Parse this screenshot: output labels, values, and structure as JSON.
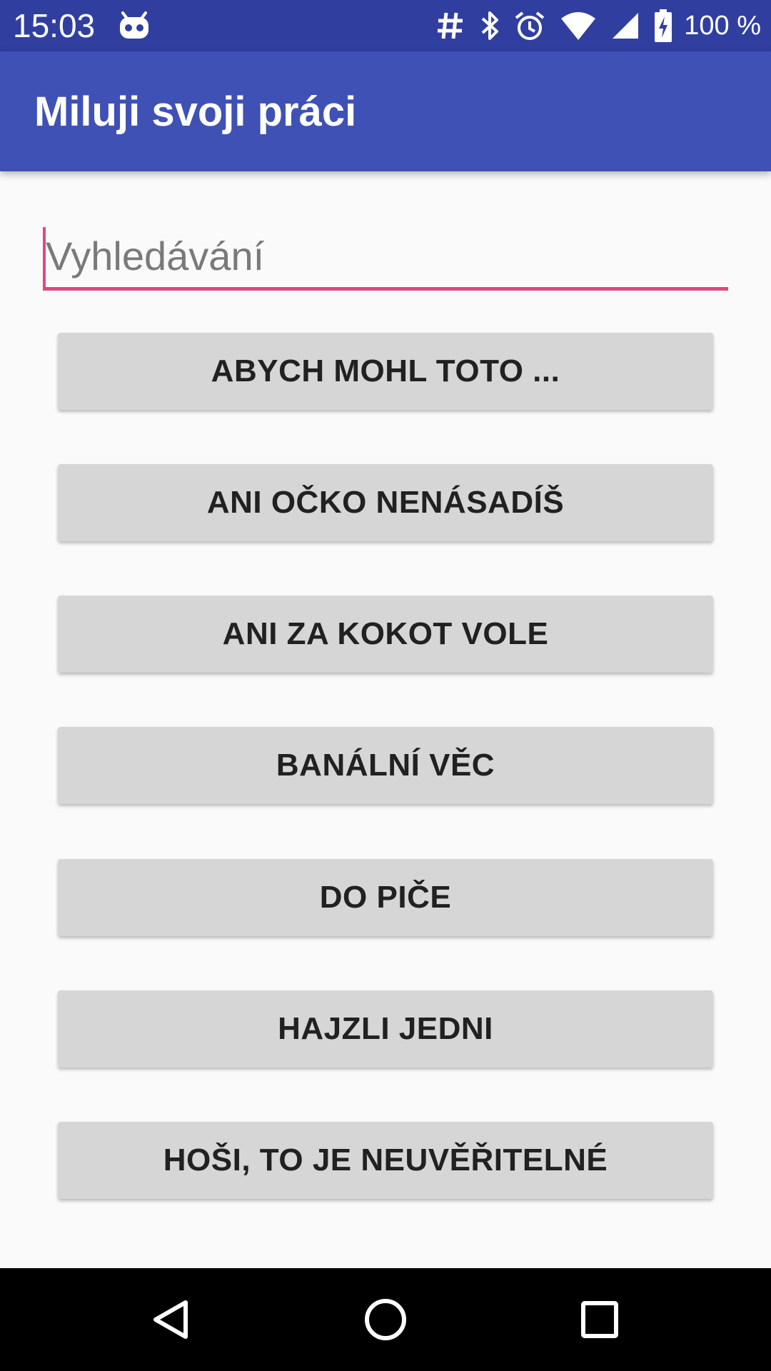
{
  "status_bar": {
    "time": "15:03",
    "battery": "100 %",
    "icons": [
      "cyanogen-icon",
      "hash-icon",
      "bluetooth-icon",
      "alarm-icon",
      "wifi-icon",
      "signal-icon",
      "battery-charging-icon"
    ]
  },
  "app_bar": {
    "title": "Miluji svoji práci"
  },
  "search": {
    "placeholder": "Vyhledávání",
    "value": "",
    "accent_color": "#e0487f"
  },
  "buttons": [
    "ABYCH MOHL TOTO ...",
    "ANI OČKO NENÁSADÍŠ",
    "ANI ZA KOKOT VOLE",
    "BANÁLNÍ VĚC",
    "DO PIČE",
    "HAJZLI JEDNI",
    "HOŠI, TO JE NEUVĚŘITELNÉ"
  ],
  "nav_bar": {
    "icons": [
      "back-icon",
      "home-icon",
      "recents-icon"
    ]
  },
  "colors": {
    "status_bar": "#303f9f",
    "app_bar": "#3f51b5",
    "background": "#fafafa",
    "button": "#d6d6d6"
  }
}
